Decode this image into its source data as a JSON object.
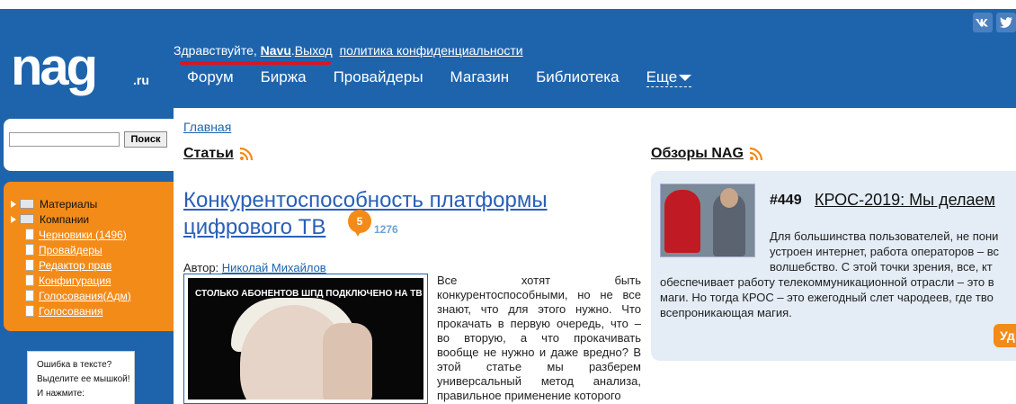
{
  "header": {
    "logo_text": "nag",
    "logo_suffix": ".ru",
    "social": [
      "vk",
      "twitter"
    ],
    "greeting": "Здравствуйте, ",
    "username": "Navu",
    "logout": "Выход",
    "privacy": "политика конфиденциальности",
    "nav": [
      "Форум",
      "Биржа",
      "Провайдеры",
      "Магазин",
      "Библиотека"
    ],
    "nav_more": "Еще",
    "accent_color": "#1e64ad",
    "underline_color": "#e0141e"
  },
  "sidebar": {
    "search_placeholder": "",
    "search_button": "Поиск",
    "tree": [
      {
        "label": "Материалы",
        "type": "folder"
      },
      {
        "label": "Компании",
        "type": "folder"
      },
      {
        "label": "Черновики (1496)",
        "type": "doc"
      },
      {
        "label": "Провайдеры",
        "type": "doc"
      },
      {
        "label": "Редактор прав",
        "type": "doc"
      },
      {
        "label": "Конфигурация",
        "type": "doc"
      },
      {
        "label": "Голосования(Адм)",
        "type": "doc"
      },
      {
        "label": "Голосования",
        "type": "doc"
      }
    ],
    "menu_color": "#f38b19",
    "error_notice": [
      "Ошибка в тексте?",
      "Выделите ее мышкой!",
      "И нажмите:"
    ]
  },
  "main": {
    "breadcrumb": "Главная",
    "articles_title": "Статьи",
    "article": {
      "title": "Конкурентоспособность платформы цифрового ТВ",
      "comments": "5",
      "views": "1276",
      "author_label": "Автор: ",
      "author_name": "Николай Михайлов",
      "image_caption": "СТОЛЬКО АБОНЕНТОВ ШПД ПОДКЛЮЧЕНО НА ТВ",
      "text": "Все хотят быть конкурентоспособными, но не все знают, что для этого нужно. Что прокачать в первую очередь, что – во вторую, а что прокачивать вообще не нужно и даже вредно? В этой статье мы разберем универсальный метод анализа, правильное применение которого"
    },
    "reviews_title": "Обзоры NAG",
    "review": {
      "number": "#449",
      "title": "КРОС-2019: Мы делаем",
      "text_lines": [
        "Для большинства пользователей, не пони",
        "устроен интернет, работа операторов – вс",
        "волшебство. С этой точки зрения, все, кт",
        "обеспечивает работу телекоммуникационной отрасли – это в",
        "маги. Но тогда КРОС – это ежегодный слет чародеев, где тво",
        "всепроникающая магия."
      ],
      "button": "Уд"
    }
  }
}
